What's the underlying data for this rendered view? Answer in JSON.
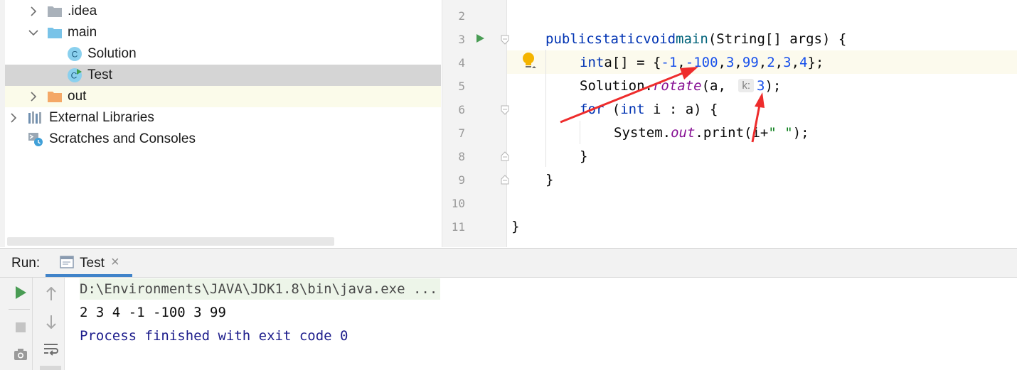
{
  "project_tree": {
    "items": [
      {
        "label": ".idea",
        "type": "folder",
        "expanded": false
      },
      {
        "label": "main",
        "type": "folder",
        "expanded": true
      },
      {
        "label": "Solution",
        "type": "class"
      },
      {
        "label": "Test",
        "type": "runnable-class",
        "selected": true
      },
      {
        "label": "out",
        "type": "folder",
        "expanded": false
      },
      {
        "label": "External Libraries",
        "type": "libraries"
      },
      {
        "label": "Scratches and Consoles",
        "type": "scratches"
      }
    ]
  },
  "editor": {
    "line_numbers": [
      "2",
      "3",
      "4",
      "5",
      "6",
      "7",
      "8",
      "9",
      "10",
      "11"
    ],
    "current_line": "4",
    "code": {
      "l3": {
        "kw1": "public",
        "kw2": "static",
        "kw3": "void",
        "method": "main",
        "rest": "(String[] args) {"
      },
      "l4": {
        "kw": "int",
        "var": "a[] = {",
        "n1": "-1",
        "n2": "-100",
        "n3": "3",
        "n4": "99",
        "n5": "2",
        "n6": "3",
        "n7": "4",
        "end": "};"
      },
      "l5": {
        "pre": "Solution.",
        "method": "rotate",
        "args": "(a, ",
        "hint": "k:",
        "val": "3",
        "end": ");"
      },
      "l6": {
        "kw": "for",
        "rest1": " (",
        "kw2": "int",
        "rest2": " i : a) {"
      },
      "l7": {
        "pre": "System.",
        "field": "out",
        "mid": ".print(i+",
        "str": "\" \"",
        "end": ");"
      },
      "l8": "}",
      "l9": "}",
      "l11": "}"
    }
  },
  "run_panel": {
    "title": "Run:",
    "tab_label": "Test",
    "close_glyph": "×",
    "console": {
      "command": "D:\\Environments\\JAVA\\JDK1.8\\bin\\java.exe ...",
      "output": "2 3 4 -1 -100 3 99",
      "exit": "Process finished with exit code 0"
    }
  },
  "colors": {
    "keyword": "#0033b3",
    "number": "#1750eb",
    "string": "#067d17",
    "static_field": "#871094",
    "annotation_arrow": "#ee2c2c",
    "run_green": "#499c54"
  }
}
